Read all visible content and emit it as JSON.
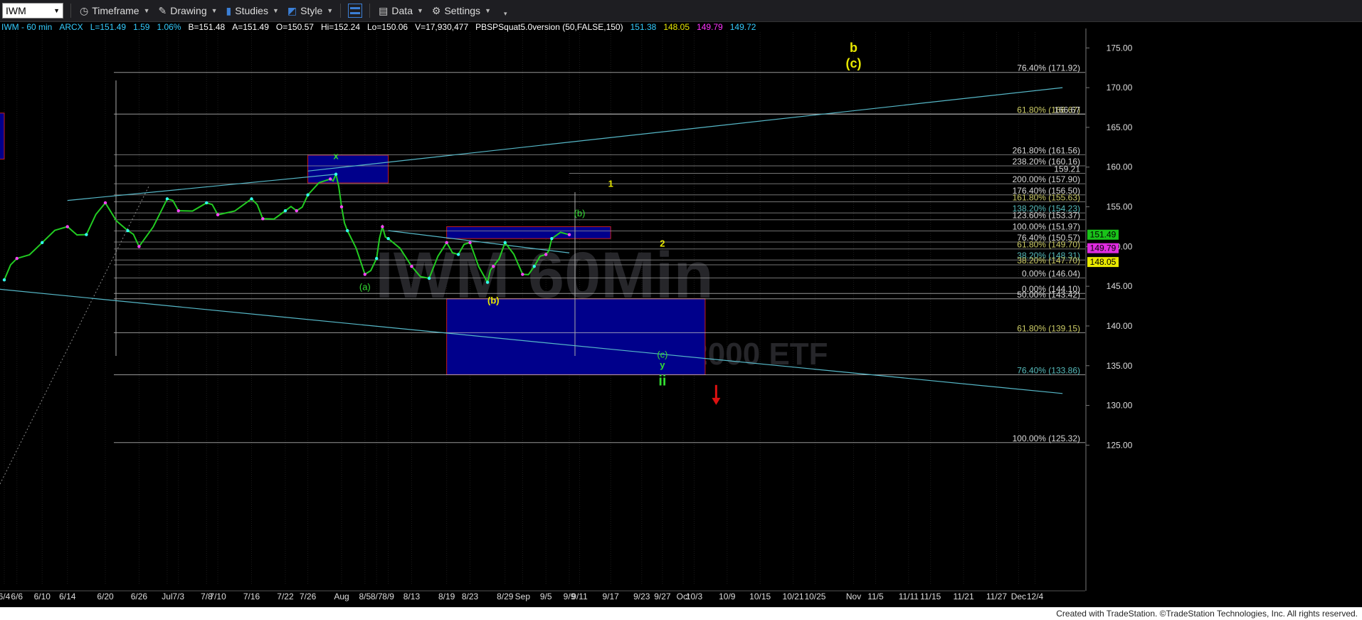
{
  "toolbar": {
    "symbol": "IWM",
    "timeframe": "Timeframe",
    "drawing": "Drawing",
    "studies": "Studies",
    "style": "Style",
    "data": "Data",
    "settings": "Settings"
  },
  "status": {
    "symbol_interval": "IWM - 60 min",
    "exchange": "ARCX",
    "last": "L=151.49",
    "change": "1.59",
    "change_pct": "1.06%",
    "bid": "B=151.48",
    "ask": "A=151.49",
    "open": "O=150.57",
    "high": "Hi=152.24",
    "low": "Lo=150.06",
    "volume": "V=17,930,477",
    "study": "PBSPSquat5.0version (50,FALSE,150)",
    "study_values": [
      {
        "text": "151.38",
        "color": "#33ccff"
      },
      {
        "text": "148.05",
        "color": "#e8e800"
      },
      {
        "text": "149.79",
        "color": "#ff33ff"
      },
      {
        "text": "149.72",
        "color": "#33ccff"
      }
    ]
  },
  "watermark": {
    "line1": "IWM 60Min",
    "line2": "iShs Russell 2000 ETF"
  },
  "footer": "Created with TradeStation. ©TradeStation Technologies, Inc. All rights reserved.",
  "chart_data": {
    "type": "line",
    "ylim": [
      121,
      177
    ],
    "price_axis_labels": [
      125,
      130,
      135,
      140,
      145,
      150,
      155,
      160,
      165,
      170,
      175
    ],
    "x_tick_labels": [
      "6/4",
      "6/6",
      "6/10",
      "6/14",
      "6/20",
      "6/26",
      "Jul",
      "7/3",
      "7/8",
      "7/10",
      "7/16",
      "7/22",
      "7/26",
      "Aug",
      "8/5",
      "8/7",
      "8/9",
      "8/13",
      "8/19",
      "8/23",
      "8/29",
      "Sep",
      "9/5",
      "9/9",
      "9/11",
      "9/17",
      "9/23",
      "9/27",
      "Oct",
      "10/3",
      "10/9",
      "10/15",
      "10/21",
      "10/25",
      "Nov",
      "11/5",
      "11/11",
      "11/15",
      "11/21",
      "11/27",
      "Dec",
      "12/4"
    ],
    "price_series": [
      [
        "6/4",
        145.8
      ],
      [
        "6/6",
        148.5
      ],
      [
        "6/10",
        150.5
      ],
      [
        "6/14",
        152.5
      ],
      [
        "6/17",
        151.5
      ],
      [
        "6/20",
        155.5
      ],
      [
        "6/24",
        152.0
      ],
      [
        "6/26",
        150.0
      ],
      [
        "Jul",
        156.0
      ],
      [
        "7/3",
        154.5
      ],
      [
        "7/8",
        155.5
      ],
      [
        "7/10",
        154.0
      ],
      [
        "7/16",
        156.0
      ],
      [
        "7/18",
        153.5
      ],
      [
        "7/22",
        154.5
      ],
      [
        "7/24",
        154.5
      ],
      [
        "7/26",
        156.5
      ],
      [
        "7/30",
        158.5
      ],
      [
        "7/31",
        159.1
      ],
      [
        "Aug",
        155.0
      ],
      [
        "8/2",
        152.0
      ],
      [
        "8/5",
        146.5
      ],
      [
        "8/7",
        148.5
      ],
      [
        "8/8",
        152.5
      ],
      [
        "8/9",
        151.0
      ],
      [
        "8/13",
        147.5
      ],
      [
        "8/16",
        146.0
      ],
      [
        "8/19",
        150.5
      ],
      [
        "8/21",
        149.0
      ],
      [
        "8/23",
        150.5
      ],
      [
        "8/26",
        145.5
      ],
      [
        "8/27",
        147.5
      ],
      [
        "8/29",
        150.5
      ],
      [
        "Sep",
        146.5
      ],
      [
        "9/3",
        147.5
      ],
      [
        "9/5",
        149.0
      ],
      [
        "9/6",
        151.0
      ],
      [
        "9/9",
        151.49
      ]
    ],
    "fib_levels": [
      {
        "label": "76.40% (171.92)",
        "value": 171.92
      },
      {
        "label": "61.80% (166.67)",
        "value": 166.67
      },
      {
        "label": "166.67",
        "value": 166.67
      },
      {
        "label": "261.80% (161.56)",
        "value": 161.56
      },
      {
        "label": "238.20% (160.16)",
        "value": 160.16
      },
      {
        "label": "159.21",
        "value": 159.21
      },
      {
        "label": "200.00% (157.90)",
        "value": 157.9
      },
      {
        "label": "176.40% (156.50)",
        "value": 156.5
      },
      {
        "label": "161.80% (155.63)",
        "value": 155.63
      },
      {
        "label": "138.20% (154.23)",
        "value": 154.23
      },
      {
        "label": "123.60% (153.37)",
        "value": 153.37
      },
      {
        "label": "100.00% (151.97)",
        "value": 151.97
      },
      {
        "label": "76.40% (150.57)",
        "value": 150.57
      },
      {
        "label": "61.80% (149.70)",
        "value": 149.7
      },
      {
        "label": "38.20% (148.31)",
        "value": 148.31
      },
      {
        "label": "38.20% (147.70)",
        "value": 147.7
      },
      {
        "label": "0.00% (146.04)",
        "value": 146.04
      },
      {
        "label": "0.00% (144.10)",
        "value": 144.1
      },
      {
        "label": "50.00% (143.42)",
        "value": 143.42
      },
      {
        "label": "61.80% (139.15)",
        "value": 139.15
      },
      {
        "label": "76.40% (133.86)",
        "value": 133.86
      },
      {
        "label": "100.00% (125.32)",
        "value": 125.32
      }
    ],
    "price_tags": [
      {
        "text": "151.49",
        "value": 151.49,
        "bg": "#19c219",
        "fg": "#000"
      },
      {
        "text": "149.79",
        "value": 149.79,
        "bg": "#e02be0",
        "fg": "#000"
      },
      {
        "text": "148.05",
        "value": 148.05,
        "bg": "#e8e800",
        "fg": "#000"
      }
    ],
    "wave_labels": [
      {
        "text": "b",
        "color": "#e8e800",
        "x": "Nov",
        "y": 174.5
      },
      {
        "text": "(c)",
        "color": "#e8e800",
        "x": "Nov",
        "y": 172.5
      },
      {
        "text": "x",
        "color": "#33dd33",
        "x": "7/31",
        "y": 161.0
      },
      {
        "text": "1",
        "color": "#e8e800",
        "x": "9/17",
        "y": 157.5
      },
      {
        "text": "(b)",
        "color": "#33dd33",
        "x": "9/11",
        "y": 153.8
      },
      {
        "text": "2",
        "color": "#e8e800",
        "x": "9/27",
        "y": 150.0
      },
      {
        "text": "(a)",
        "color": "#33dd33",
        "x": "8/5",
        "y": 144.5
      },
      {
        "text": "(b)",
        "color": "#e8e800",
        "x": "8/27",
        "y": 142.8
      },
      {
        "text": "(c)",
        "color": "#33dd33",
        "x": "9/27",
        "y": 136.0
      },
      {
        "text": "y",
        "color": "#33dd33",
        "x": "9/27",
        "y": 134.7
      },
      {
        "text": "ii",
        "color": "#33dd33",
        "x": "9/27",
        "y": 132.5
      }
    ],
    "target_zones": [
      {
        "from": "8/19",
        "to": "10/5",
        "low": 133.86,
        "high": 143.42
      },
      {
        "from": "7/26",
        "to": "8/9",
        "low": 158.0,
        "high": 161.5
      },
      {
        "from": "8/19",
        "to": "9/17",
        "low": 151.0,
        "high": 152.5
      },
      {
        "from": "6/1",
        "to": "6/4",
        "low": 161.0,
        "high": 166.8
      }
    ],
    "trend_lines": [
      {
        "from": [
          "6/1",
          144.8
        ],
        "to": [
          "12/9",
          131.5
        ]
      },
      {
        "from": [
          "6/14",
          155.8
        ],
        "to": [
          "7/31",
          159.1
        ]
      },
      {
        "from": [
          "7/26",
          159.5
        ],
        "to": [
          "12/9",
          170.0
        ]
      },
      {
        "from": [
          "8/9",
          152.0
        ],
        "to": [
          "9/9",
          149.2
        ]
      }
    ],
    "down_arrow": {
      "x": "10/7",
      "y": 131.5,
      "color": "#dd1111"
    }
  }
}
